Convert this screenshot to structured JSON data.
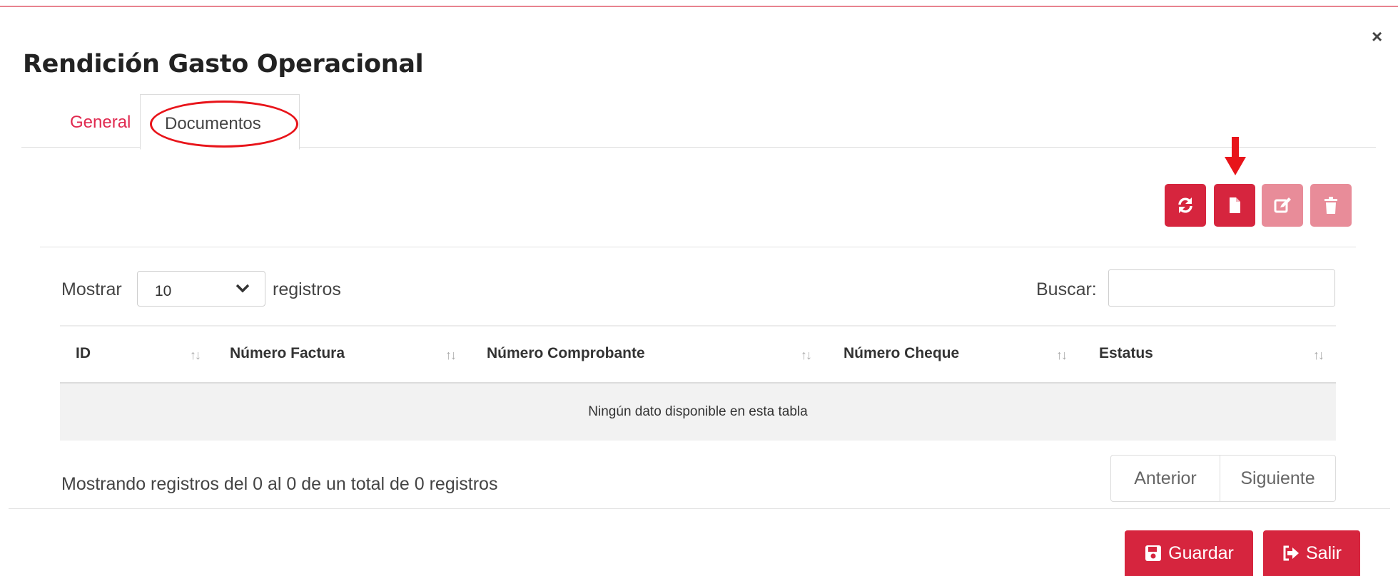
{
  "modal": {
    "title": "Rendición Gasto Operacional",
    "close_glyph": "×"
  },
  "tabs": [
    {
      "label": "General",
      "active": false
    },
    {
      "label": "Documentos",
      "active": true
    }
  ],
  "toolbar": {
    "buttons": [
      {
        "icon": "refresh-icon",
        "state": "enabled"
      },
      {
        "icon": "new-document-icon",
        "state": "enabled"
      },
      {
        "icon": "edit-icon",
        "state": "disabled"
      },
      {
        "icon": "trash-icon",
        "state": "disabled"
      }
    ]
  },
  "table_controls": {
    "show_label": "Mostrar",
    "page_size": "10",
    "records_label": "registros",
    "search_label": "Buscar:",
    "search_value": ""
  },
  "table": {
    "columns": [
      "ID",
      "Número Factura",
      "Número Comprobante",
      "Número Cheque",
      "Estatus"
    ],
    "sort_glyph": "↑↓",
    "empty_message": "Ningún dato disponible en esta tabla"
  },
  "footer_info": "Mostrando registros del 0 al 0 de un total de 0 registros",
  "pagination": {
    "prev": "Anterior",
    "next": "Siguiente"
  },
  "actions": {
    "save": "Guardar",
    "exit": "Salir"
  },
  "colors": {
    "accent": "#d6253e",
    "accent_disabled": "#e88c99",
    "annotation": "#e8141a",
    "tab_link": "#e0294f"
  }
}
